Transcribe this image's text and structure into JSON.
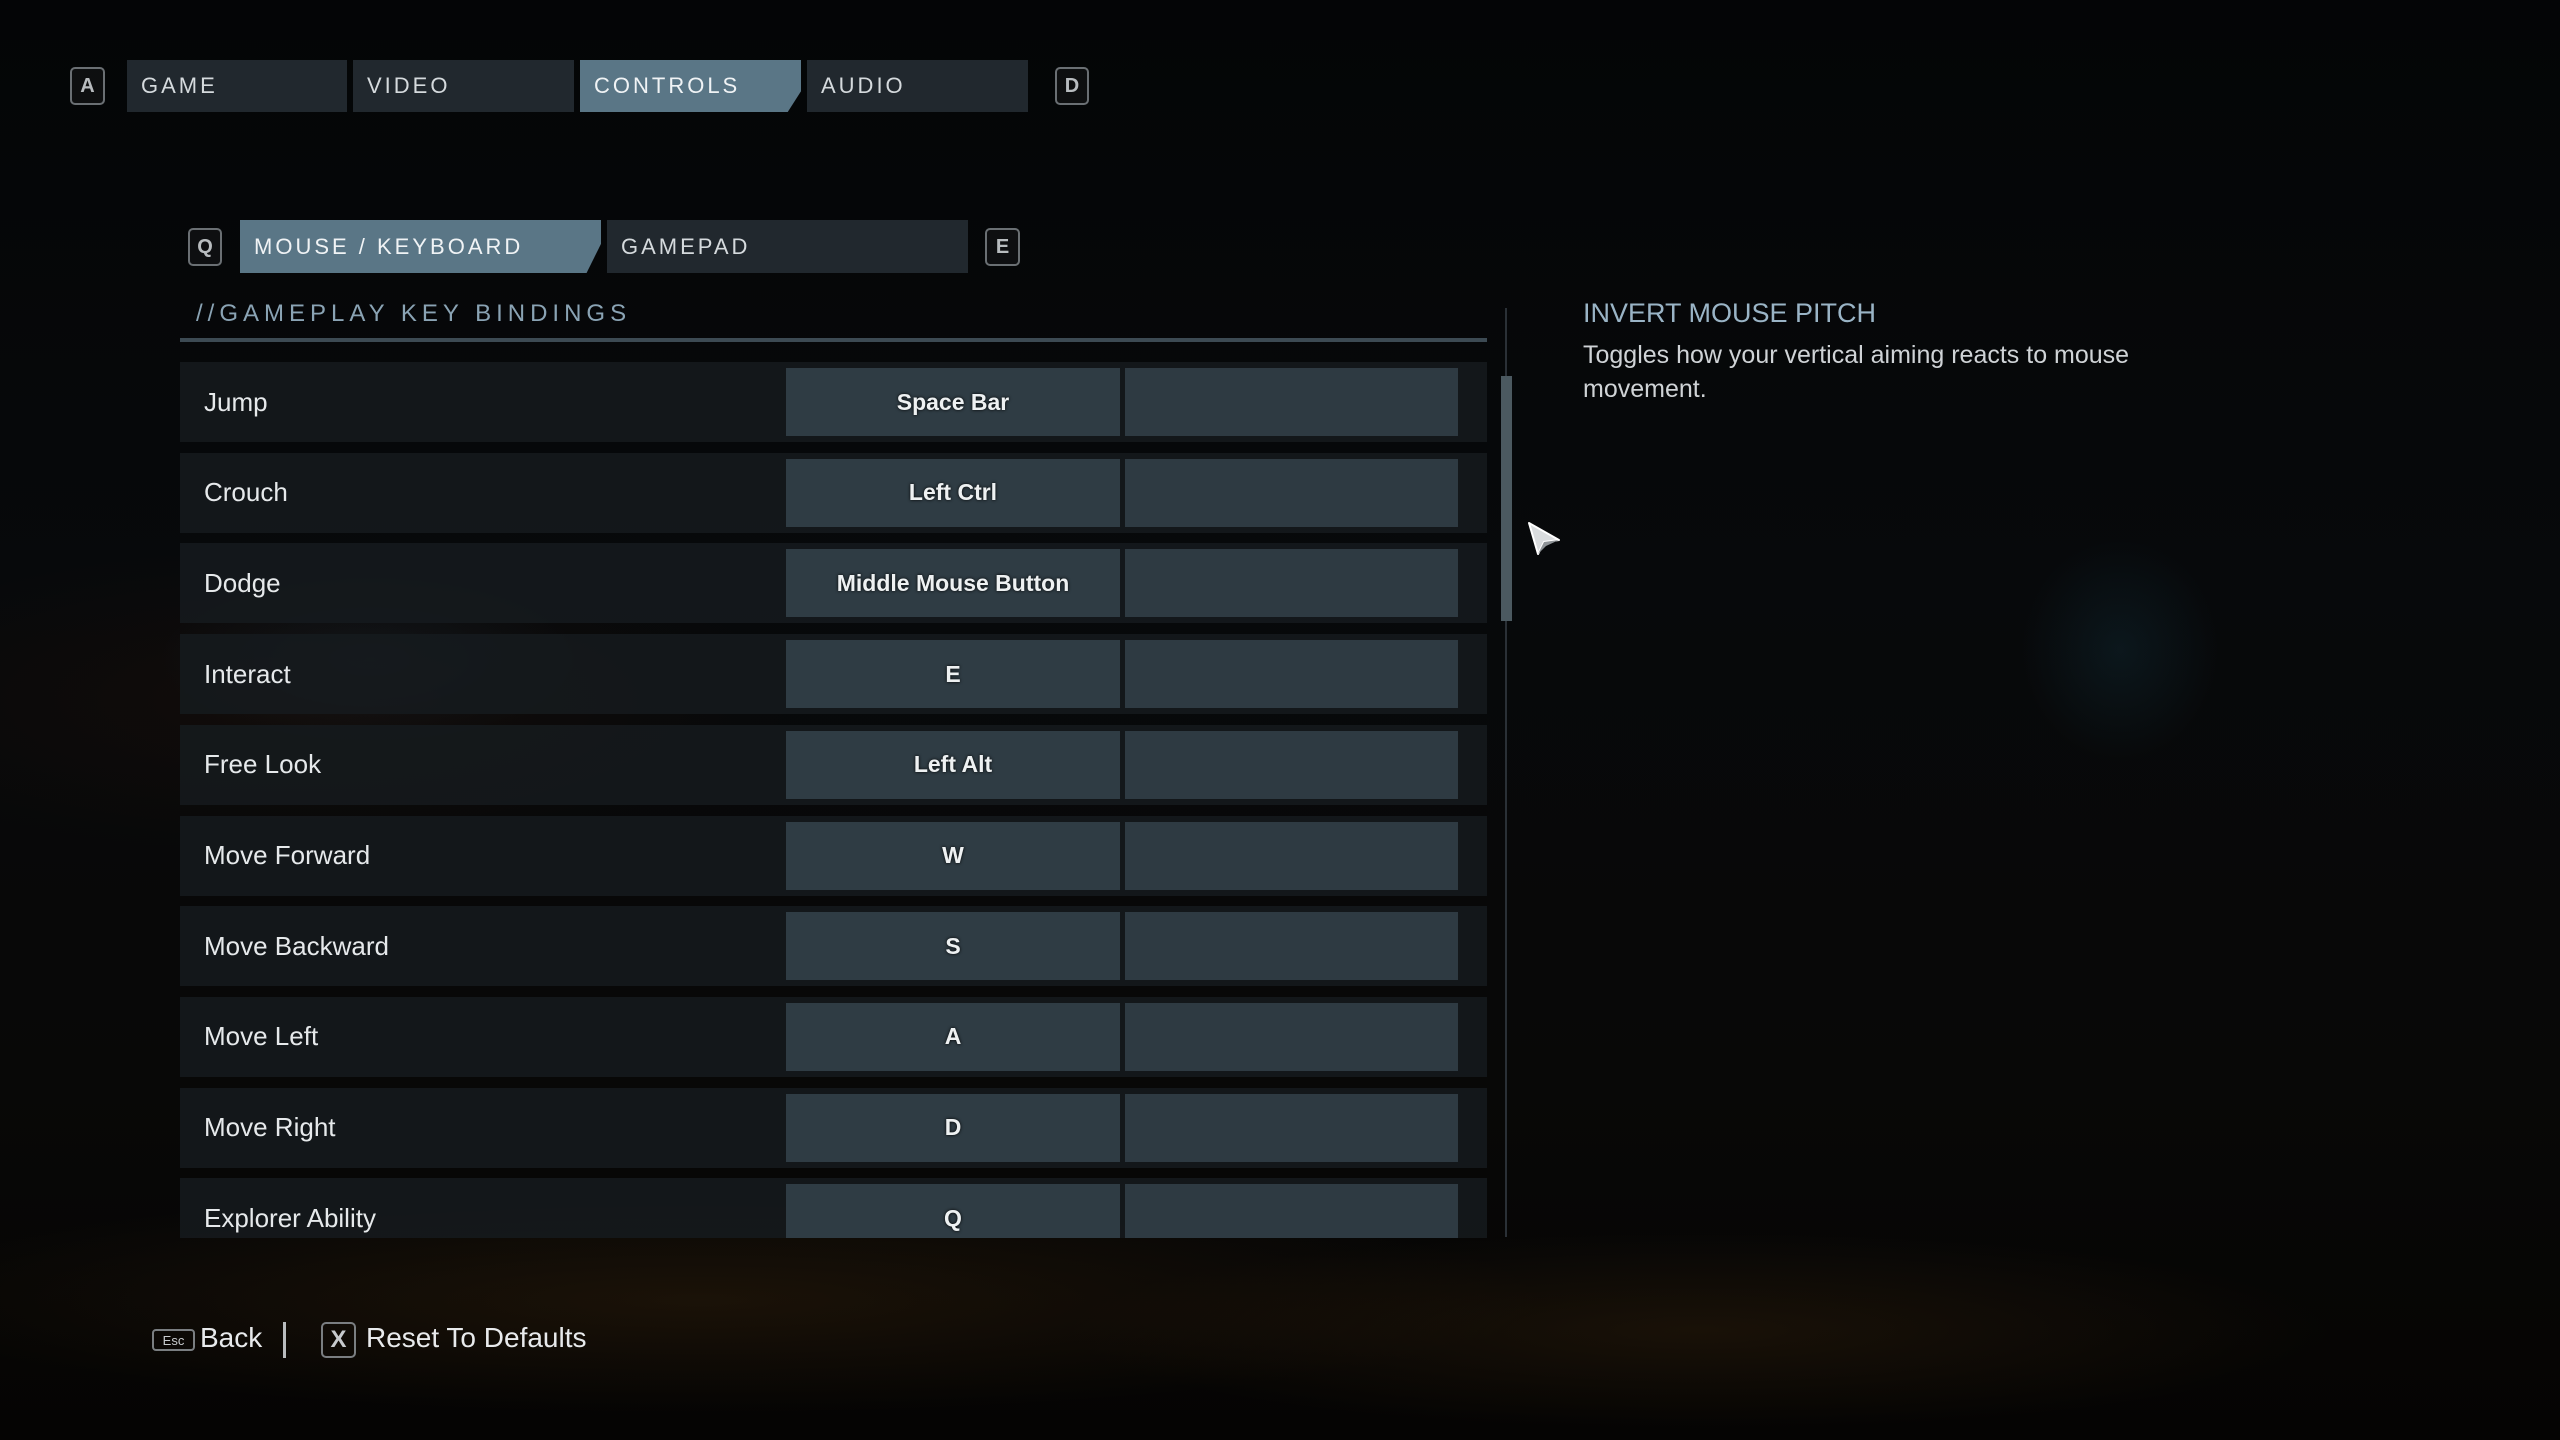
{
  "top_tabs": {
    "prev_key": "A",
    "next_key": "D",
    "items": [
      {
        "label": "GAME",
        "active": false
      },
      {
        "label": "VIDEO",
        "active": false
      },
      {
        "label": "CONTROLS",
        "active": true
      },
      {
        "label": "AUDIO",
        "active": false
      }
    ]
  },
  "sub_tabs": {
    "prev_key": "Q",
    "next_key": "E",
    "items": [
      {
        "label": "MOUSE / KEYBOARD",
        "active": true
      },
      {
        "label": "GAMEPAD",
        "active": false
      }
    ]
  },
  "section": {
    "title": "//GAMEPLAY KEY BINDINGS"
  },
  "bindings": [
    {
      "action": "Jump",
      "primary": "Space Bar",
      "secondary": ""
    },
    {
      "action": "Crouch",
      "primary": "Left Ctrl",
      "secondary": ""
    },
    {
      "action": "Dodge",
      "primary": "Middle Mouse Button",
      "secondary": ""
    },
    {
      "action": "Interact",
      "primary": "E",
      "secondary": ""
    },
    {
      "action": "Free Look",
      "primary": "Left Alt",
      "secondary": ""
    },
    {
      "action": "Move Forward",
      "primary": "W",
      "secondary": ""
    },
    {
      "action": "Move Backward",
      "primary": "S",
      "secondary": ""
    },
    {
      "action": "Move Left",
      "primary": "A",
      "secondary": ""
    },
    {
      "action": "Move Right",
      "primary": "D",
      "secondary": ""
    },
    {
      "action": "Explorer Ability",
      "primary": "Q",
      "secondary": ""
    }
  ],
  "description": {
    "title": "INVERT MOUSE PITCH",
    "body": "Toggles how your vertical aiming reacts to mouse movement."
  },
  "footer": {
    "back_key": "Esc",
    "back_label": "Back",
    "reset_key": "X",
    "reset_label": "Reset To Defaults"
  },
  "colors": {
    "active_tab": "#5a7686",
    "inactive_tab": "#21282e",
    "accent_text": "#9ab4c6"
  }
}
